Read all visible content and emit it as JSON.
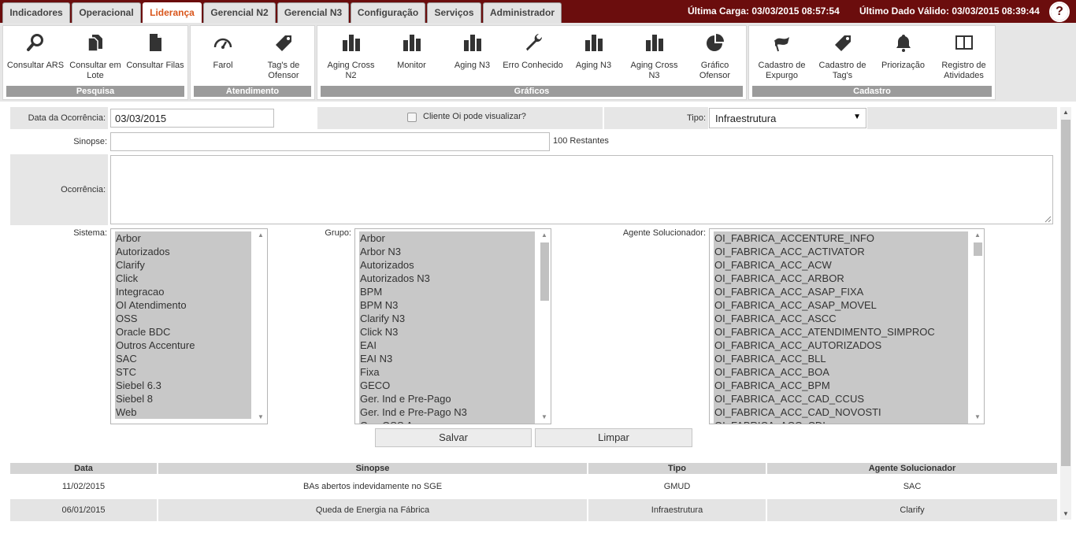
{
  "tabs": [
    {
      "label": "Indicadores"
    },
    {
      "label": "Operacional"
    },
    {
      "label": "Liderança"
    },
    {
      "label": "Gerencial N2"
    },
    {
      "label": "Gerencial N3"
    },
    {
      "label": "Configuração"
    },
    {
      "label": "Serviços"
    },
    {
      "label": "Administrador"
    }
  ],
  "header": {
    "ultima_carga": "Última Carga: 03/03/2015 08:57:54",
    "ultimo_dado": "Último Dado Válido: 03/03/2015 08:39:44",
    "help": "?"
  },
  "ribbon": {
    "pesquisa": {
      "title": "Pesquisa",
      "buttons": [
        "Consultar ARS",
        "Consultar em Lote",
        "Consultar Filas"
      ]
    },
    "atendimento": {
      "title": "Atendimento",
      "buttons": [
        "Farol",
        "Tag's de Ofensor"
      ]
    },
    "graficos": {
      "title": "Gráficos",
      "buttons": [
        "Aging Cross N2",
        "Monitor",
        "Aging N3",
        "Erro Conhecido",
        "Aging N3",
        "Aging Cross N3",
        "Gráfico Ofensor"
      ]
    },
    "cadastro": {
      "title": "Cadastro",
      "buttons": [
        "Cadastro de Expurgo",
        "Cadastro de Tag's",
        "Priorização",
        "Registro de Atividades"
      ]
    }
  },
  "form": {
    "data_label": "Data da Ocorrência:",
    "data_value": "03/03/2015",
    "cliente_label": "Cliente Oi pode visualizar?",
    "tipo_label": "Tipo:",
    "tipo_value": "Infraestrutura",
    "sinopse_label": "Sinopse:",
    "sinopse_value": "",
    "restantes": "100 Restantes",
    "ocorrencia_label": "Ocorrência:",
    "sistema_label": "Sistema:",
    "sistema_options": [
      "Arbor",
      "Autorizados",
      "Clarify",
      "Click",
      "Integracao",
      "OI Atendimento",
      "OSS",
      "Oracle BDC",
      "Outros Accenture",
      "SAC",
      "STC",
      "Siebel 6.3",
      "Siebel 8",
      "Web"
    ],
    "grupo_label": "Grupo:",
    "grupo_options": [
      "Arbor",
      "Arbor N3",
      "Autorizados",
      "Autorizados N3",
      "BPM",
      "BPM N3",
      "Clarify N3",
      "Click N3",
      "EAI",
      "EAI N3",
      "Fixa",
      "GECO",
      "Ger. Ind e Pre-Pago",
      "Ger. Ind e Pre-Pago N3",
      "Ger. OSS Assurance"
    ],
    "agente_label": "Agente Solucionador:",
    "agente_options": [
      "OI_FABRICA_ACCENTURE_INFO",
      "OI_FABRICA_ACC_ACTIVATOR",
      "OI_FABRICA_ACC_ACW",
      "OI_FABRICA_ACC_ARBOR",
      "OI_FABRICA_ACC_ASAP_FIXA",
      "OI_FABRICA_ACC_ASAP_MOVEL",
      "OI_FABRICA_ACC_ASCC",
      "OI_FABRICA_ACC_ATENDIMENTO_SIMPROC",
      "OI_FABRICA_ACC_AUTORIZADOS",
      "OI_FABRICA_ACC_BLL",
      "OI_FABRICA_ACC_BOA",
      "OI_FABRICA_ACC_BPM",
      "OI_FABRICA_ACC_CAD_CCUS",
      "OI_FABRICA_ACC_CAD_NOVOSTI",
      "OI_FABRICA_ACC_CDI"
    ],
    "salvar": "Salvar",
    "limpar": "Limpar"
  },
  "table": {
    "headers": [
      "Data",
      "Sinopse",
      "Tipo",
      "Agente Solucionador"
    ],
    "rows": [
      [
        "11/02/2015",
        "BAs abertos indevidamente no SGE",
        "GMUD",
        "SAC"
      ],
      [
        "06/01/2015",
        "Queda de Energia na Fábrica",
        "Infraestrutura",
        "Clarify"
      ]
    ]
  },
  "colors": {
    "topbar": "#6b0d0d",
    "active_tab": "#d9561c",
    "group_footer": "#9b9b9b"
  },
  "icons": [
    "search-icon",
    "documents-icon",
    "document-icon",
    "gauge-icon",
    "tag-icon",
    "bar-chart-icon",
    "wrench-icon",
    "pie-chart-icon",
    "flag-icon",
    "bell-icon",
    "book-icon"
  ]
}
